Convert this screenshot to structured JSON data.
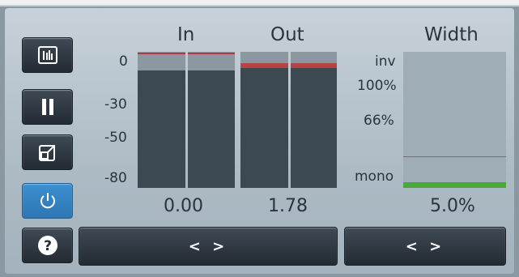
{
  "meters": {
    "in": {
      "title": "In",
      "value": "0.00"
    },
    "out": {
      "title": "Out",
      "value": "1.78"
    },
    "scale": [
      "0",
      "-30",
      "-50",
      "-80"
    ]
  },
  "width": {
    "title": "Width",
    "value": "5.0%",
    "scale": [
      "inv",
      "100%",
      "66%",
      "mono"
    ]
  },
  "side_buttons": [
    {
      "icon": "meter-bars-icon"
    },
    {
      "icon": "pause-icon"
    },
    {
      "icon": "resize-icon"
    },
    {
      "icon": "power-icon"
    },
    {
      "icon": "help-icon",
      "label": "?"
    }
  ],
  "bottom_buttons": [
    {
      "label": "< >"
    },
    {
      "label": "< >"
    }
  ],
  "colors": {
    "accent_blue": "#3b8fd0",
    "peak_red": "#b03a3a",
    "width_green": "#4aa83e"
  }
}
